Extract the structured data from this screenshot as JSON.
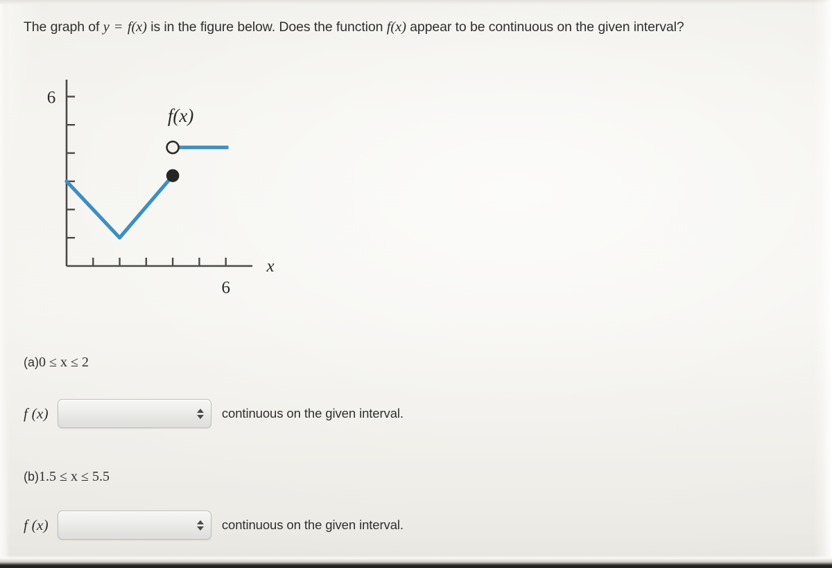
{
  "prompt": {
    "segment_1": "The graph of",
    "var_y": "y",
    "equals": "=",
    "func_1": "f",
    "arg_1": "(x)",
    "segment_2": "is in the figure below. Does the function",
    "func_2": "f",
    "arg_2": "(x)",
    "segment_3": "appear to be continuous on the given interval?"
  },
  "figure": {
    "curve_label": "f(x)",
    "x_axis_label": "x",
    "y_axis_top_label": "6",
    "x_axis_end_label": "6",
    "curve_color": "#3d8fc0",
    "axis_color": "#4a4a48",
    "closed_point_color": "#262626"
  },
  "parts": [
    {
      "tag": "(a)",
      "interval": "0 ≤ x ≤ 2",
      "answer": {
        "fx_label": "f (x)",
        "selected": "",
        "placeholder": "",
        "suffix": "continuous on the given interval."
      }
    },
    {
      "tag": "(b)",
      "interval": "1.5 ≤ x ≤ 5.5",
      "answer": {
        "fx_label": "f (x)",
        "selected": "",
        "placeholder": "",
        "suffix": "continuous on the given interval."
      }
    }
  ],
  "chart_data": {
    "type": "line",
    "title": "",
    "xlabel": "x",
    "ylabel": "",
    "xlim": [
      0,
      7
    ],
    "ylim": [
      0,
      6.6
    ],
    "grid": false,
    "legend": "inline-label",
    "x_ticks": [
      1,
      2,
      3,
      4,
      5,
      6
    ],
    "y_ticks": [
      1,
      2,
      3,
      4,
      5,
      6
    ],
    "x_tick_labels": [
      "",
      "",
      "",
      "",
      "",
      "6"
    ],
    "y_tick_labels": [
      "",
      "",
      "",
      "",
      "",
      "6"
    ],
    "series": [
      {
        "name": "f(x)",
        "type": "piecewise-linear",
        "points": [
          {
            "x": 0,
            "y": 3.0
          },
          {
            "x": 2,
            "y": 1.0
          },
          {
            "x": 4,
            "y": 3.2
          }
        ]
      },
      {
        "name": "f(x)",
        "type": "segment",
        "points": [
          {
            "x": 4,
            "y": 4.2
          },
          {
            "x": 6.1,
            "y": 4.2
          }
        ]
      }
    ],
    "markers": [
      {
        "kind": "open-circle",
        "x": 4,
        "y": 4.2
      },
      {
        "kind": "closed-circle",
        "x": 4,
        "y": 3.2
      }
    ],
    "annotations": [
      {
        "text": "f(x)",
        "x": 4.3,
        "y": 5.1
      }
    ]
  }
}
